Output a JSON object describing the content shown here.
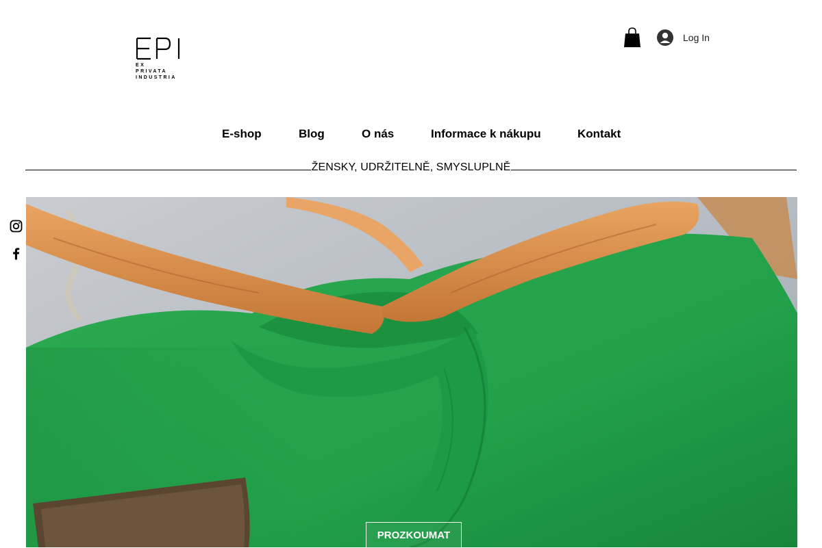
{
  "brand": {
    "logo_mark": "EPI",
    "logo_lines": [
      "EX",
      "PRIVATA",
      "INDUSTRIA"
    ]
  },
  "header": {
    "cart_icon": "shopping-bag-icon",
    "login_icon": "user-avatar-icon",
    "login_label": "Log In"
  },
  "nav": {
    "items": [
      {
        "label": "E-shop"
      },
      {
        "label": "Blog"
      },
      {
        "label": "O nás"
      },
      {
        "label": "Informace k nákupu"
      },
      {
        "label": "Kontakt"
      }
    ]
  },
  "tagline": "ŽENSKY, UDRŽITELNĚ, SMYSLUPLNĚ",
  "social": {
    "items": [
      {
        "icon": "instagram-icon"
      },
      {
        "icon": "facebook-icon"
      }
    ]
  },
  "hero": {
    "image_subject": "green t-shirt on wooden hanger",
    "cta_label": "PROZKOUMAT"
  },
  "colors": {
    "shirt_green": "#22a04a",
    "hanger_wood": "#d9894a",
    "background": "#ffffff"
  }
}
